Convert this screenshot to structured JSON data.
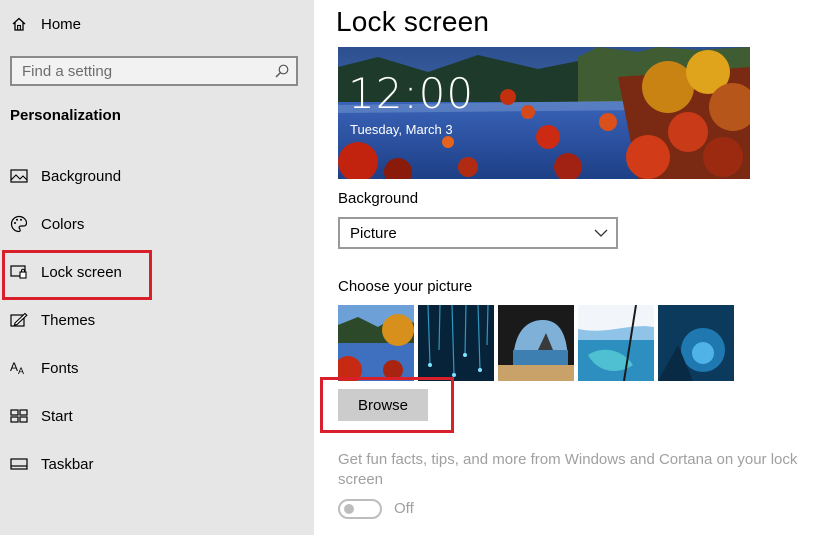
{
  "sidebar": {
    "home_label": "Home",
    "search_placeholder": "Find a setting",
    "section_title": "Personalization",
    "items": [
      {
        "label": "Background",
        "icon": "picture-icon"
      },
      {
        "label": "Colors",
        "icon": "palette-icon"
      },
      {
        "label": "Lock screen",
        "icon": "lock-screen-icon",
        "selected": true
      },
      {
        "label": "Themes",
        "icon": "themes-icon"
      },
      {
        "label": "Fonts",
        "icon": "fonts-icon"
      },
      {
        "label": "Start",
        "icon": "start-icon"
      },
      {
        "label": "Taskbar",
        "icon": "taskbar-icon"
      }
    ]
  },
  "main": {
    "title": "Lock screen",
    "preview": {
      "time": "12:00",
      "date": "Tuesday, March 3"
    },
    "background_label": "Background",
    "background_value": "Picture",
    "choose_label": "Choose your picture",
    "thumbnails": [
      "lake-autumn",
      "glowworm-cave",
      "sea-cave-beach",
      "cliff-ocean",
      "ice-cave"
    ],
    "browse_label": "Browse",
    "fun_facts_text": "Get fun facts, tips, and more from Windows and Cortana on your lock screen",
    "toggle_label": "Off",
    "toggle_on": false
  },
  "colors": {
    "highlight": "#d9202a",
    "sidebar_bg": "#e6e6e6",
    "disabled_text": "#a0a0a0"
  }
}
